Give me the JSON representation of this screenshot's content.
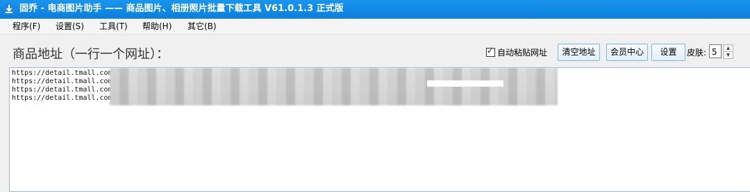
{
  "window": {
    "title": "固乔 - 电商图片助手 —— 商品图片、相册照片批量下载工具 V61.0.1.3 正式版",
    "app_icon": "download-icon"
  },
  "menu": {
    "items": [
      {
        "label": "程序(F)"
      },
      {
        "label": "设置(S)"
      },
      {
        "label": "工具(T)"
      },
      {
        "label": "帮助(H)"
      },
      {
        "label": "其它(B)"
      }
    ]
  },
  "toolbar": {
    "url_label": "商品地址（一行一个网址）：",
    "auto_paste_label": "自动粘贴网址",
    "auto_paste_checked": true,
    "clear_label": "清空地址",
    "member_label": "会员中心",
    "settings_label": "设置",
    "skin_label": "皮肤:",
    "skin_value": "5"
  },
  "urls": [
    "https://detail.tmall.com",
    "https://detail.tmall.com",
    "https://detail.tmall.com",
    "https://detail.tmall.com"
  ],
  "colors": {
    "titlebar": "#0a7fdb",
    "button_border": "#7eb4ea"
  }
}
